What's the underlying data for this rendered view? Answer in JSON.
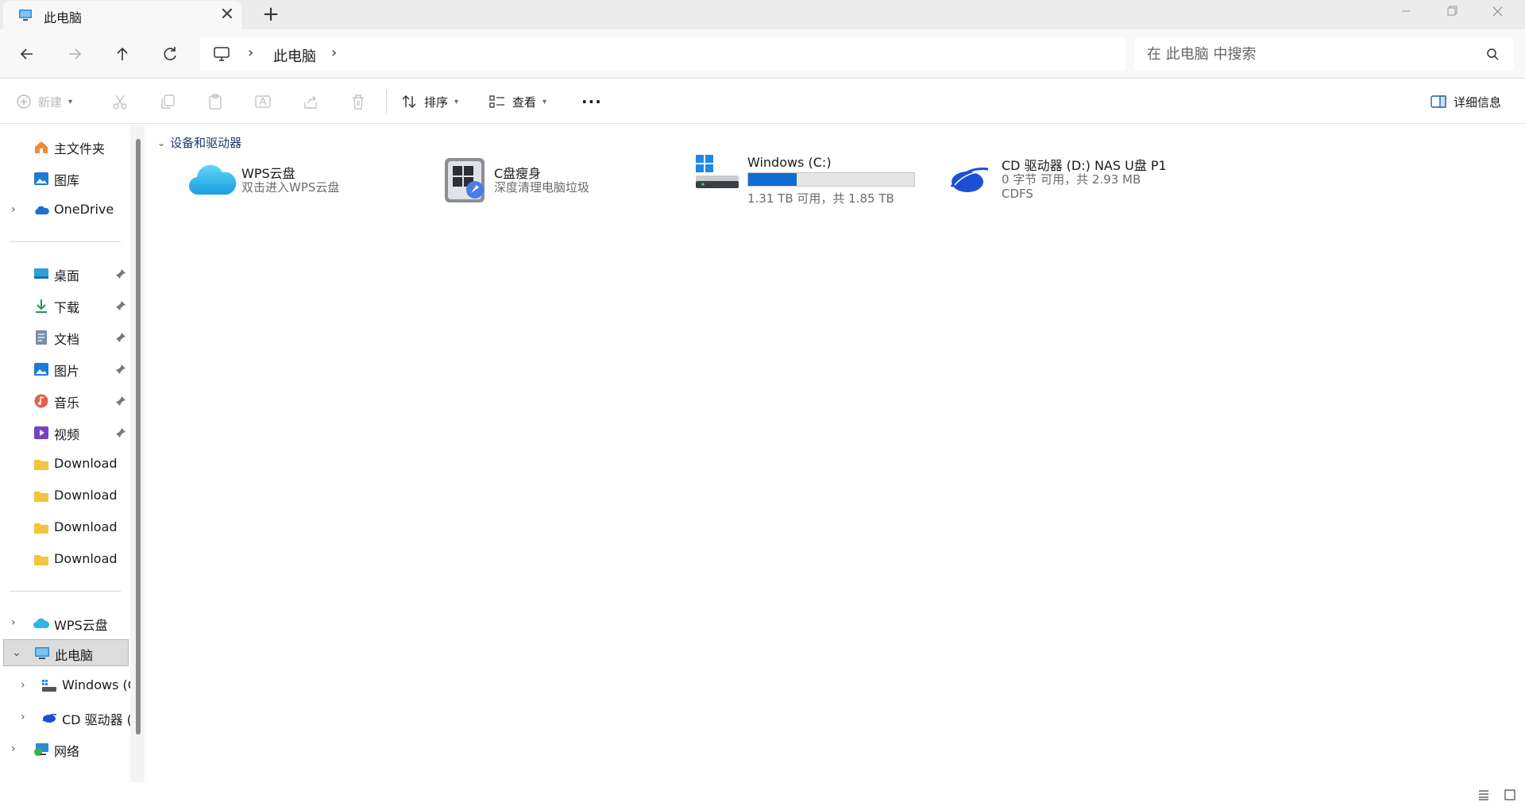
{
  "tab": {
    "title": "此电脑",
    "close": "✕"
  },
  "new_tab_label": "+",
  "address": {
    "separator": "›",
    "crumbs": [
      "此电脑"
    ]
  },
  "search": {
    "placeholder": "在 此电脑 中搜索",
    "value": ""
  },
  "commands": {
    "new": "新建",
    "sort": "排序",
    "view": "查看",
    "more": "···",
    "details": "详细信息"
  },
  "nav": {
    "quick": [
      {
        "label": "主文件夹",
        "icon": "home-icon"
      },
      {
        "label": "图库",
        "icon": "gallery-icon"
      },
      {
        "label": "OneDrive",
        "icon": "onedrive-icon"
      }
    ],
    "pinned": [
      {
        "label": "桌面",
        "icon": "desktop-icon"
      },
      {
        "label": "下载",
        "icon": "download-icon"
      },
      {
        "label": "文档",
        "icon": "document-icon"
      },
      {
        "label": "图片",
        "icon": "picture-icon"
      },
      {
        "label": "音乐",
        "icon": "music-icon"
      },
      {
        "label": "视频",
        "icon": "video-icon"
      },
      {
        "label": "Download",
        "icon": "folder-icon"
      },
      {
        "label": "Download",
        "icon": "folder-icon"
      },
      {
        "label": "Download",
        "icon": "folder-icon"
      },
      {
        "label": "Download",
        "icon": "folder-icon"
      }
    ],
    "tree": [
      {
        "label": "WPS云盘",
        "icon": "wps-cloud-icon"
      },
      {
        "label": "此电脑",
        "icon": "computer-icon"
      },
      {
        "label": "Windows (C",
        "icon": "drive-icon"
      },
      {
        "label": "CD 驱动器 (D",
        "icon": "cd-drive-icon"
      },
      {
        "label": "网络",
        "icon": "network-icon"
      }
    ]
  },
  "content": {
    "group_title": "设备和驱动器",
    "items": [
      {
        "name": "WPS云盘",
        "subtitle": "双击进入WPS云盘",
        "icon": "wps-cloud-icon"
      },
      {
        "name": "C盘瘦身",
        "subtitle": "深度清理电脑垃圾",
        "icon": "disk-cleanup-icon"
      },
      {
        "name": "Windows (C:)",
        "subtitle": "1.31 TB 可用，共 1.85 TB",
        "icon": "windows-drive-icon",
        "used_fraction": 0.29
      },
      {
        "name": "CD 驱动器 (D:) NAS U盘 P1",
        "subtitle": "0 字节 可用，共 2.93 MB",
        "filesystem": "CDFS",
        "icon": "cd-drive-icon"
      }
    ]
  },
  "colors": {
    "accent": "#0f6cd2",
    "selected_bg": "#dcdcdc",
    "group_header": "#1d3a6e",
    "folder": "#f5c43c"
  }
}
